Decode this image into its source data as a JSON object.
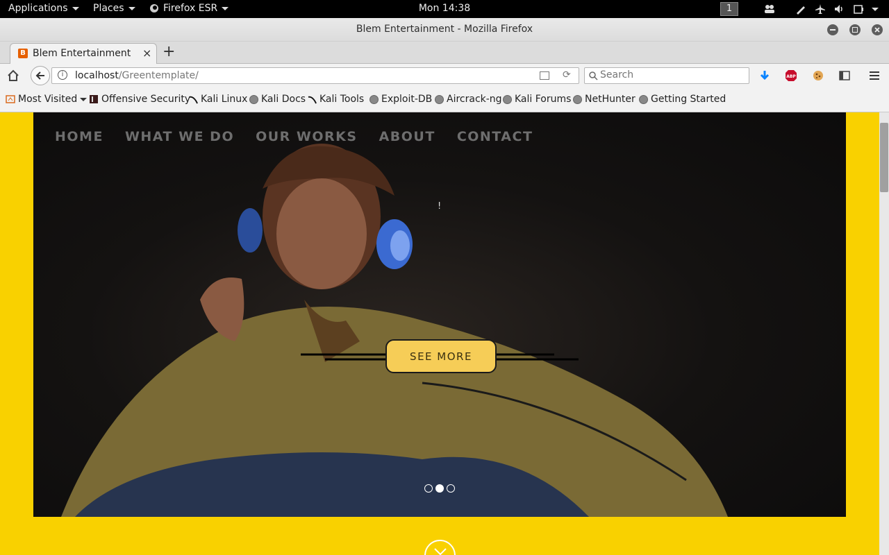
{
  "topbar": {
    "applications": "Applications",
    "places": "Places",
    "firefox_menu": "Firefox ESR",
    "clock": "Mon 14:38",
    "workspace": "1"
  },
  "window": {
    "title": "Blem Entertainment - Mozilla Firefox"
  },
  "tabs": [
    {
      "label": "Blem Entertainment"
    }
  ],
  "navbar": {
    "url_host": "localhost",
    "url_path": "/Greentemplate/",
    "search_placeholder": "Search"
  },
  "bookmarks": [
    {
      "label": "Most Visited",
      "icon": "most-visited-icon"
    },
    {
      "label": "Offensive Security",
      "icon": "offsec-icon"
    },
    {
      "label": "Kali Linux",
      "icon": "kali-icon"
    },
    {
      "label": "Kali Docs",
      "icon": "globe-icon"
    },
    {
      "label": "Kali Tools",
      "icon": "kali-icon"
    },
    {
      "label": "Exploit-DB",
      "icon": "globe-icon"
    },
    {
      "label": "Aircrack-ng",
      "icon": "globe-icon"
    },
    {
      "label": "Kali Forums",
      "icon": "globe-icon"
    },
    {
      "label": "NetHunter",
      "icon": "globe-icon"
    },
    {
      "label": "Getting Started",
      "icon": "globe-icon"
    }
  ],
  "site": {
    "menu": [
      "HOME",
      "WHAT WE DO",
      "OUR WORKS",
      "ABOUT",
      "CONTACT"
    ],
    "hero_mark": "!",
    "cta": "SEE MORE",
    "slide_count": 3,
    "active_slide": 2
  },
  "colors": {
    "page_background": "#f9d100",
    "cta_background": "#f6cd57",
    "menu_text": "#6e6e6e"
  }
}
